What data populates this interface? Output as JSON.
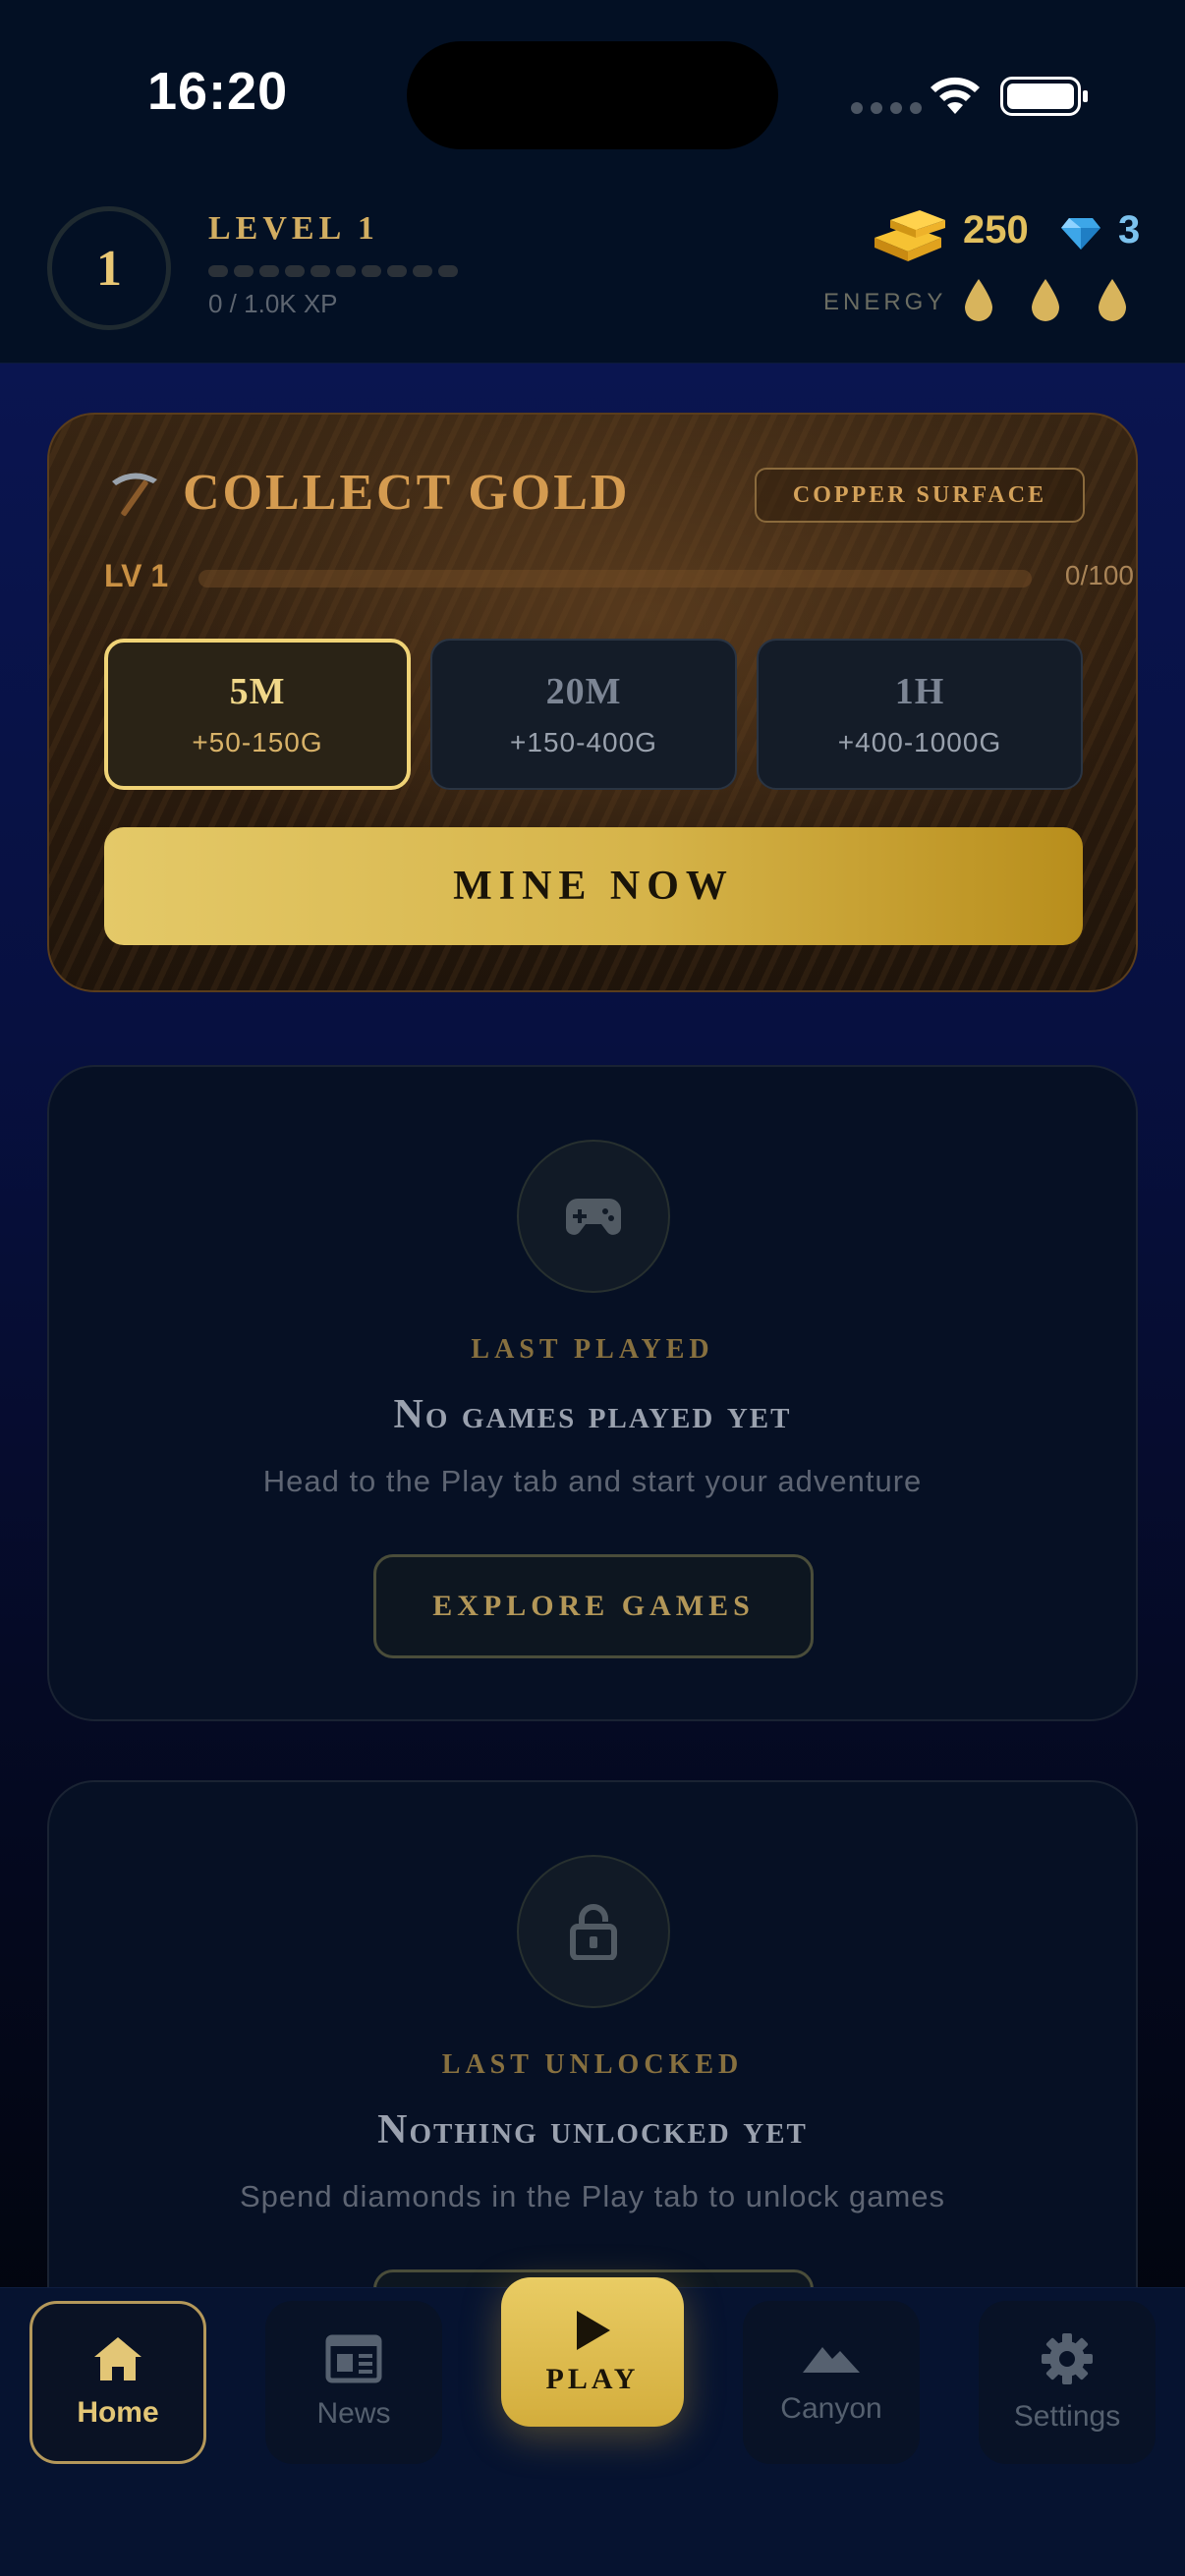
{
  "status_bar": {
    "time": "16:20"
  },
  "header": {
    "level_number": "1",
    "level_title": "LEVEL 1",
    "xp_text": "0 / 1.0K XP",
    "gold": "250",
    "diamonds": "3",
    "energy_label": "ENERGY",
    "energy_drops": 3
  },
  "collect_card": {
    "title": "COLLECT GOLD",
    "badge": "COPPER SURFACE",
    "level": "LV 1",
    "progress_text": "0/100",
    "progress_fraction": 0,
    "durations": [
      {
        "time": "5M",
        "reward": "+50-150G",
        "selected": true
      },
      {
        "time": "20M",
        "reward": "+150-400G",
        "selected": false
      },
      {
        "time": "1H",
        "reward": "+400-1000G",
        "selected": false
      }
    ],
    "action": "MINE NOW"
  },
  "last_played": {
    "label": "LAST PLAYED",
    "title": "No games played yet",
    "subtitle": "Head to the Play tab and start your adventure",
    "button": "EXPLORE GAMES"
  },
  "last_unlocked": {
    "label": "LAST UNLOCKED",
    "title": "Nothing unlocked yet",
    "subtitle": "Spend diamonds in the Play tab to unlock games"
  },
  "nav": {
    "home": "Home",
    "news": "News",
    "play": "PLAY",
    "canyon": "Canyon",
    "settings": "Settings"
  },
  "colors": {
    "accent_gold": "#e3c05e",
    "diamond_blue": "#7cc2ee",
    "background": "#031024"
  }
}
